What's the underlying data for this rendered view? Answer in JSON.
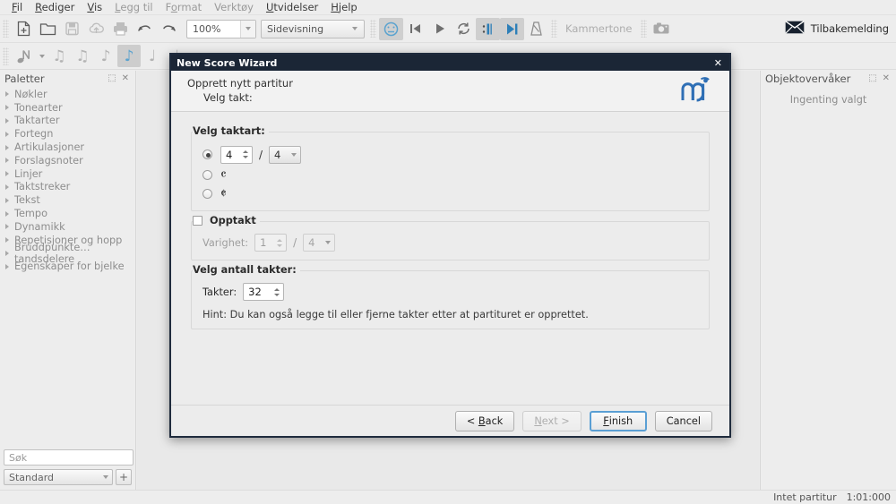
{
  "menubar": {
    "items": [
      {
        "label": "Fil",
        "mnemonic": "F",
        "enabled": true
      },
      {
        "label": "Rediger",
        "mnemonic": "R",
        "enabled": true
      },
      {
        "label": "Vis",
        "mnemonic": "V",
        "enabled": true
      },
      {
        "label": "Legg til",
        "mnemonic": "L",
        "enabled": false
      },
      {
        "label": "Format",
        "mnemonic": "o",
        "enabled": false
      },
      {
        "label": "Verktøy",
        "mnemonic": "",
        "enabled": false
      },
      {
        "label": "Utvidelser",
        "mnemonic": "U",
        "enabled": true
      },
      {
        "label": "Hjelp",
        "mnemonic": "H",
        "enabled": true
      }
    ]
  },
  "toolbar": {
    "new_icon": "new-document-icon",
    "open_icon": "open-folder-icon",
    "save_icon": "save-icon",
    "save_online_icon": "save-online-cloud-icon",
    "print_icon": "print-icon",
    "undo_icon": "undo-icon",
    "redo_icon": "redo-icon",
    "zoom_value": "100%",
    "view_mode_value": "Sidevisning",
    "play_panel_icon": "play-panel-icon",
    "rewind_icon": "rewind-to-start-icon",
    "play_icon": "play-icon",
    "loop_icon": "loop-playback-icon",
    "play_repeats_icon": "play-repeats-icon",
    "metronome_icon": "metronome-icon",
    "count_in_icon": "count-in-icon",
    "concert_pitch_label": "Kammertone",
    "image_capture_icon": "image-capture-camera-icon",
    "feedback_label": "Tilbakemelding",
    "feedback_icon": "envelope-icon"
  },
  "notebar": {
    "note_input_label": "N",
    "durations": [
      {
        "name": "duration-64th",
        "glyph": "♫",
        "selected": false
      },
      {
        "name": "duration-32nd",
        "glyph": "♫",
        "selected": false
      },
      {
        "name": "duration-16th",
        "glyph": "♪",
        "selected": false
      },
      {
        "name": "duration-8th",
        "glyph": "♪",
        "selected": true
      },
      {
        "name": "duration-quarter",
        "glyph": "♩",
        "selected": false
      },
      {
        "name": "duration-half",
        "glyph": "♩",
        "selected": false
      }
    ]
  },
  "palettes": {
    "title": "Paletter",
    "float_icon": "undock-icon",
    "close_icon": "close-icon",
    "items": [
      {
        "label": "Nøkler"
      },
      {
        "label": "Tonearter"
      },
      {
        "label": "Taktarter"
      },
      {
        "label": "Fortegn"
      },
      {
        "label": "Artikulasjoner"
      },
      {
        "label": "Forslagsnoter"
      },
      {
        "label": "Linjer"
      },
      {
        "label": "Taktstreker"
      },
      {
        "label": "Tekst"
      },
      {
        "label": "Tempo"
      },
      {
        "label": "Dynamikk"
      },
      {
        "label": "Repetisjoner og hopp"
      },
      {
        "label": "Bruddpunkte…tandsdelere"
      },
      {
        "label": "Egenskaper for bjelke"
      }
    ],
    "search_placeholder": "Søk",
    "workspace_value": "Standard",
    "add_workspace_label": "+"
  },
  "inspector": {
    "title": "Objektovervåker",
    "float_icon": "undock-icon",
    "close_icon": "close-icon",
    "empty_message": "Ingenting valgt"
  },
  "statusbar": {
    "score_status": "Intet partitur",
    "timecode": "1:01:000"
  },
  "dialog": {
    "title": "New Score Wizard",
    "close_icon": "close-icon",
    "header_line1": "Opprett nytt partitur",
    "header_line2": "Velg takt:",
    "logo_icon": "musescore-logo-icon",
    "time_signature": {
      "group_title": "Velg taktart:",
      "custom_selected": true,
      "numerator": "4",
      "denominator": "4",
      "slash": "/",
      "common_time_symbol": "𝄴",
      "cut_time_symbol": "𝄵",
      "common_selected": false,
      "cut_selected": false
    },
    "pickup": {
      "checkbox_label": "Opptakt",
      "checked": false,
      "duration_label": "Varighet:",
      "numerator": "1",
      "denominator": "4",
      "slash": "/",
      "enabled": false
    },
    "measures": {
      "group_title": "Velg antall takter:",
      "measures_label": "Takter:",
      "measures_value": "32",
      "hint": "Hint: Du kan også legge til eller fjerne takter etter at partituret er opprettet."
    },
    "buttons": {
      "back": "< Back",
      "back_mnemonic": "B",
      "next": "Next >",
      "next_mnemonic": "N",
      "next_enabled": false,
      "finish": "Finish",
      "finish_mnemonic": "F",
      "finish_default": true,
      "cancel": "Cancel"
    }
  },
  "colors": {
    "accent_blue": "#5ba3cf",
    "dialog_titlebar": "#1b2636",
    "window_bg": "#ededed",
    "logo_blue": "#2f6fb5"
  }
}
